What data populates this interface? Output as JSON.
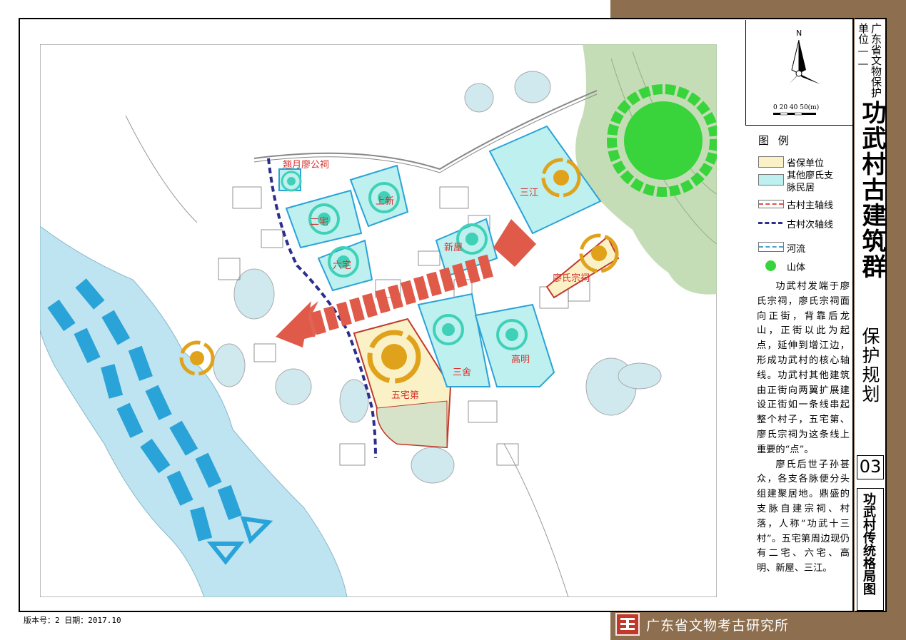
{
  "header": {
    "project_small": "广东省文物保护单位——",
    "project_big": "功武村古建筑群",
    "project_sub": "保护规划"
  },
  "sheet": {
    "number": "03",
    "title": "功武村传统格局图"
  },
  "north_arrow": {
    "letter": "N",
    "scale_text": "0  20  40 50(m)"
  },
  "legend": {
    "title": "图 例",
    "items": [
      {
        "label": "省保单位",
        "color": "#fbf1c7",
        "kind": "fill"
      },
      {
        "label": "其他廖氏支脉民居",
        "color": "#bdf0ee",
        "kind": "fill"
      },
      {
        "label": "古村主轴线",
        "color": "#d9534f",
        "kind": "dash"
      },
      {
        "label": "古村次轴线",
        "color": "#2c2f8c",
        "kind": "dash"
      },
      {
        "label": "河流",
        "color": "#49a3d6",
        "kind": "dash"
      },
      {
        "label": "山体",
        "color": "#39d43b",
        "kind": "dot"
      }
    ]
  },
  "description": [
    "功武村发端于廖氏宗祠，廖氏宗祠面向正街，背靠后龙山，正街以此为起点，延伸到增江边，形成功武村的核心轴线。功武村其他建筑由正街向两翼扩展建设正街如一条线串起整个村子，五宅第、廖氏宗祠为这条线上重要的“点”。",
    "廖氏后世子孙甚众，各支各脉便分头组建聚居地。鼎盛的支脉自建宗祠、村落，人称“功武十三村”。五宅第周边现仍有二宅、六宅、高明、新屋、三江。"
  ],
  "map_labels": {
    "chaoyue": "翘月廖公祠",
    "erzhai": "二宅",
    "shangxin": "上新",
    "liuzhai": "六宅",
    "xinwu": "新屋",
    "sanjiang": "三江",
    "zongci": "廖氏宗祠",
    "sanshe": "三舍",
    "gaoming": "高明",
    "wuzhaidi": "五宅第"
  },
  "footer": {
    "version": "版本号：2   日期：2017.10",
    "institute": "广东省文物考古研究所"
  },
  "colors": {
    "band": "#8d6e4e",
    "river": "#bde4f0",
    "river_arrow": "#2aa3d8",
    "main_axis": "#e05a4a",
    "secondary_axis": "#2c2f8c",
    "mountain": "#39d43b",
    "cyan_node": "#3fd1b7",
    "gold_node": "#e0a21a"
  }
}
